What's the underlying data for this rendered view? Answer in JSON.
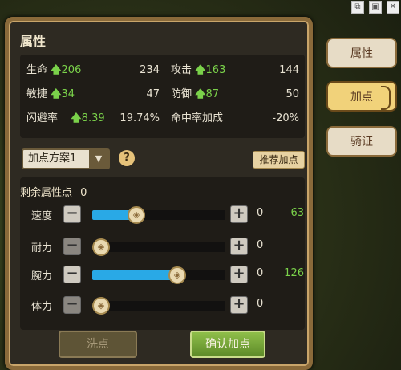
{
  "title": "属性",
  "stats": {
    "rows": [
      {
        "left_label": "生命",
        "left_bonus": "206",
        "left_total": "234",
        "right_label": "攻击",
        "right_bonus": "163",
        "right_total": "144"
      },
      {
        "left_label": "敏捷",
        "left_bonus": "34",
        "left_total": "47",
        "right_label": "防御",
        "right_bonus": "87",
        "right_total": "50"
      },
      {
        "left_label": "闪避率",
        "left_bonus": "8.39",
        "left_total": "19.74%",
        "right_label": "命中率加成",
        "right_bonus": "",
        "right_total": "-20%"
      }
    ]
  },
  "plan": {
    "selected": "加点方案1",
    "help": "?",
    "recommend_label": "推荐加点"
  },
  "remaining": {
    "label": "剩余属性点",
    "value": "0"
  },
  "attributes": [
    {
      "name": "速度",
      "added": "0",
      "value": "63",
      "fill_fraction": 0.33
    },
    {
      "name": "耐力",
      "added": "0",
      "value": "",
      "fill_fraction": 0.0
    },
    {
      "name": "腕力",
      "added": "0",
      "value": "126",
      "fill_fraction": 0.64
    },
    {
      "name": "体力",
      "added": "0",
      "value": "",
      "fill_fraction": 0.0
    }
  ],
  "buttons": {
    "reset": "洗点",
    "confirm": "确认加点",
    "minus": "−",
    "plus": "+"
  },
  "tabs": [
    {
      "label": "属性",
      "active": false
    },
    {
      "label": "加点",
      "active": true
    },
    {
      "label": "骑证",
      "active": false
    }
  ],
  "colors": {
    "accent_green": "#7ad14a",
    "bar_blue": "#29a9e6",
    "frame_gold": "#8a6a3a"
  }
}
